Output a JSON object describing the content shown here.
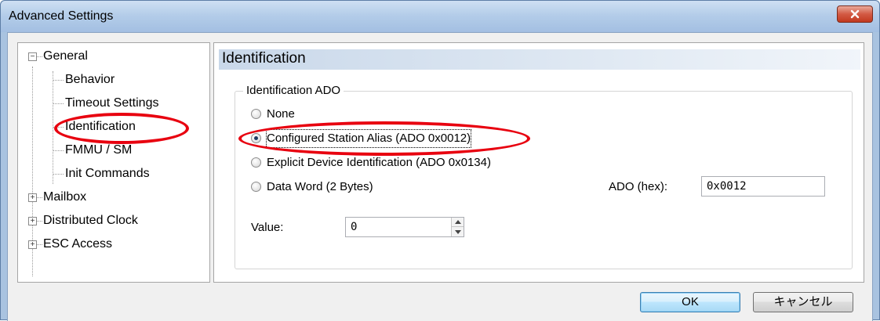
{
  "window": {
    "title": "Advanced Settings",
    "close_symbol": "✕"
  },
  "tree": {
    "items": [
      {
        "label": "General",
        "expander": "−"
      },
      {
        "label": "Behavior"
      },
      {
        "label": "Timeout Settings"
      },
      {
        "label": "Identification"
      },
      {
        "label": "FMMU / SM"
      },
      {
        "label": "Init Commands"
      },
      {
        "label": "Mailbox",
        "expander": "+"
      },
      {
        "label": "Distributed Clock",
        "expander": "+"
      },
      {
        "label": "ESC Access",
        "expander": "+"
      }
    ]
  },
  "panel": {
    "title": "Identification",
    "group_title": "Identification ADO",
    "options": [
      {
        "label": "None",
        "checked": false
      },
      {
        "label": "Configured Station Alias (ADO 0x0012)",
        "checked": true
      },
      {
        "label": "Explicit Device Identification (ADO 0x0134)",
        "checked": false
      },
      {
        "label": "Data Word (2 Bytes)",
        "checked": false
      }
    ],
    "ado_label": "ADO (hex):",
    "ado_value": "0x0012",
    "value_label": "Value:",
    "value_value": "0"
  },
  "buttons": {
    "ok": "OK",
    "cancel": "キャンセル"
  },
  "colors": {
    "annotation": "#e8000f",
    "title_bar": "#b4cde9",
    "close_button": "#c2391f"
  }
}
